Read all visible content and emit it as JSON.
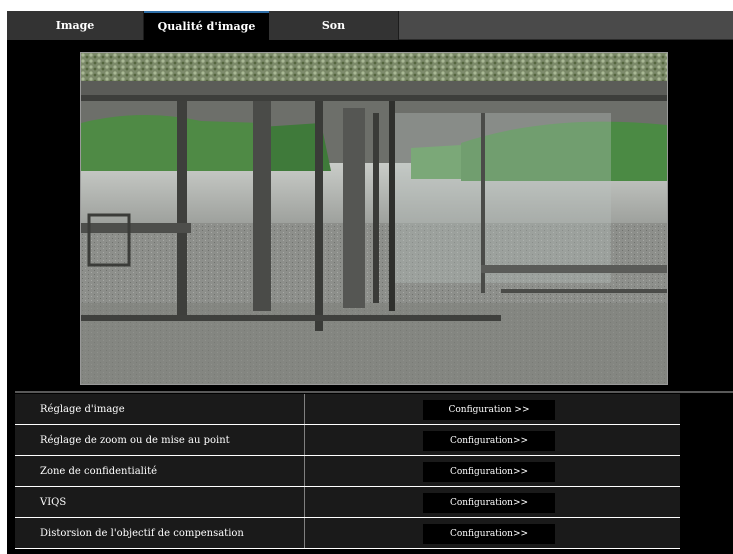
{
  "tabs": [
    {
      "label": "Image",
      "active": false
    },
    {
      "label": "Qualité d'image",
      "active": true
    },
    {
      "label": "Son",
      "active": false
    }
  ],
  "live_view": {
    "content": "camera-preview-glass-lobby",
    "colors": {
      "sky_foliage": "#6b7a5a",
      "hedge": "#3e7a3a",
      "floor": "#8c8f8c",
      "frame": "#4a4a48"
    }
  },
  "settings": [
    {
      "label": "Réglage d'image",
      "button": "Configuration >>"
    },
    {
      "label": "Réglage de zoom ou de mise au point",
      "button": "Configuration>>"
    },
    {
      "label": "Zone de confidentialité",
      "button": "Configuration>>"
    },
    {
      "label": "VIQS",
      "button": "Configuration>>"
    },
    {
      "label": "Distorsion de l'objectif de compensation",
      "button": "Configuration>>"
    }
  ],
  "colors": {
    "panel_bg": "#000000",
    "tab_bar_bg": "#4a4a4a",
    "tab_inactive_bg": "#333333",
    "tab_active_accent": "#2f6fa8",
    "row_bg": "#1a1a1a",
    "text": "#ffffff"
  }
}
